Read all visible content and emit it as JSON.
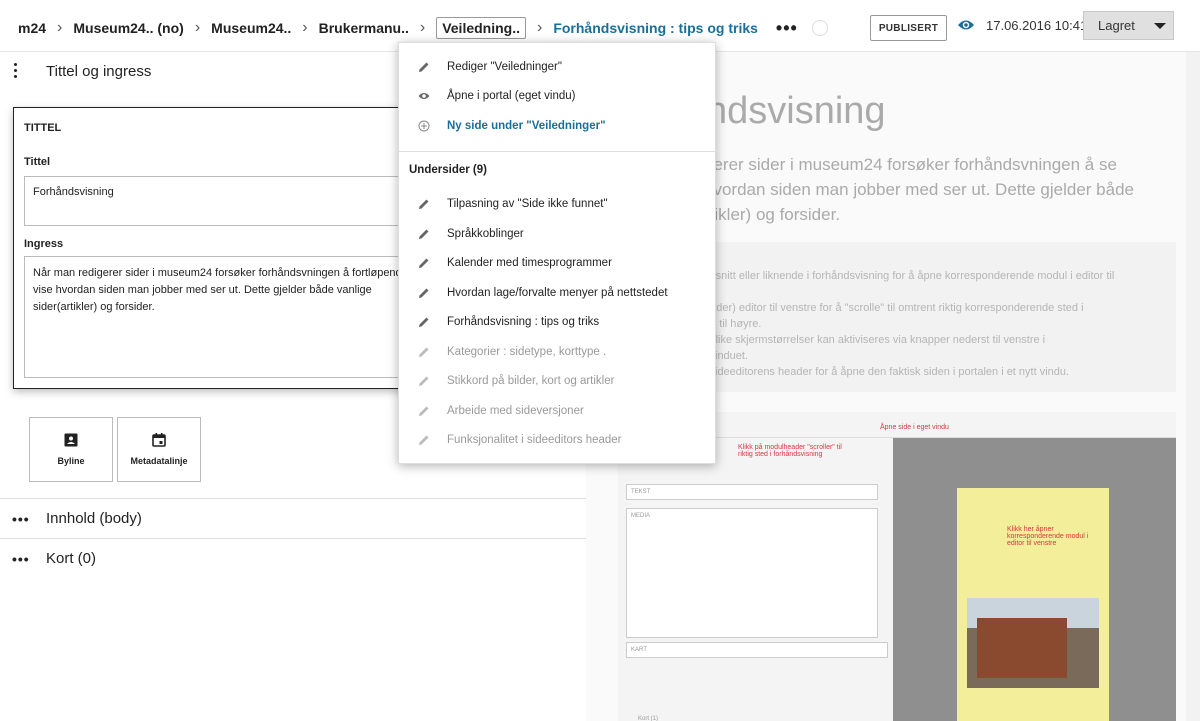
{
  "breadcrumb": {
    "items": [
      "m24",
      "Museum24.. (no)",
      "Museum24..",
      "Brukermanu..",
      "Veiledning.."
    ],
    "current": "Forhåndsvisning : tips og triks"
  },
  "toolbar": {
    "publish_label": "PUBLISERT",
    "timestamp": "17.06.2016 10:41",
    "saved_label": "Lagret"
  },
  "editor": {
    "section_title": "Tittel og ingress",
    "card_title": "TITTEL",
    "title_label": "Tittel",
    "title_value": "Forhåndsvisning",
    "ingress_label": "Ingress",
    "ingress_value": "Når man redigerer sider i museum24 forsøker forhåndsvningen å fortløpende vise hvordan siden man jobber med ser ut. Dette gjelder både vanlige sider(artikler) og forsider.",
    "tiles": [
      {
        "label": "Byline",
        "icon": "contact-card-icon"
      },
      {
        "label": "Metadatalinje",
        "icon": "calendar-icon"
      }
    ],
    "rows": [
      {
        "label": "Innhold (body)"
      },
      {
        "label": "Kort (0)"
      }
    ]
  },
  "preview": {
    "title": "ndsvisning",
    "lead": "gerer sider i museum24 forsøker forhåndsvningen å se hvordan siden man jobber med ser ut. Dette gjelder både rtikler) og forsider.",
    "list_lines": [
      "avsnitt eller liknende i forhåndsvisning for å åpne korresponderende modul i editor til",
      "",
      "eader) editor til venstre for å \"scrolle\" til omtrent riktig korresponderende sted i",
      "en til høyre.",
      "i ulike skjermstørrelser kan aktiviseres via knapper nederst til venstre i",
      "svinduet.",
      "i sideeditorens header for å åpne den faktisk siden i portalen i et nytt vindu."
    ],
    "screenshot": {
      "annotation_top": "Åpne side i eget vindu",
      "annotation_mid": "Klikk på modulheader \"scroller\" til riktig sted i forhåndsvisning",
      "annotation_right": "Klikk her åpner korresponderende modul i editor til venstre",
      "bottom_label": "Kort (1)",
      "module_label_1": "TEKST",
      "module_label_2": "MEDIA",
      "module_label_3": "KART"
    }
  },
  "menu": {
    "actions": [
      {
        "label": "Rediger \"Veiledninger\"",
        "icon": "pencil-icon"
      },
      {
        "label": "Åpne i portal (eget vindu)",
        "icon": "eye-icon"
      },
      {
        "label": "Ny side under \"Veiledninger\"",
        "icon": "plus-circle-icon"
      }
    ],
    "subpages_header": "Undersider (9)",
    "subpages": [
      {
        "label": "Tilpasning av \"Side ikke funnet\"",
        "enabled": true
      },
      {
        "label": "Språkkoblinger",
        "enabled": true
      },
      {
        "label": "Kalender med timesprogrammer",
        "enabled": true
      },
      {
        "label": "Hvordan lage/forvalte menyer på nettstedet",
        "enabled": true
      },
      {
        "label": "Forhåndsvisning : tips og triks",
        "enabled": true
      },
      {
        "label": "Kategorier : sidetype, korttype .",
        "enabled": false
      },
      {
        "label": "Stikkord på bilder, kort og artikler",
        "enabled": false
      },
      {
        "label": "Arbeide med sideversjoner",
        "enabled": false
      },
      {
        "label": "Funksjonalitet i sideeditors header",
        "enabled": false
      }
    ]
  },
  "colors": {
    "accent": "#1a6f9a",
    "text": "#222222",
    "disabled": "#9a9a9a"
  }
}
